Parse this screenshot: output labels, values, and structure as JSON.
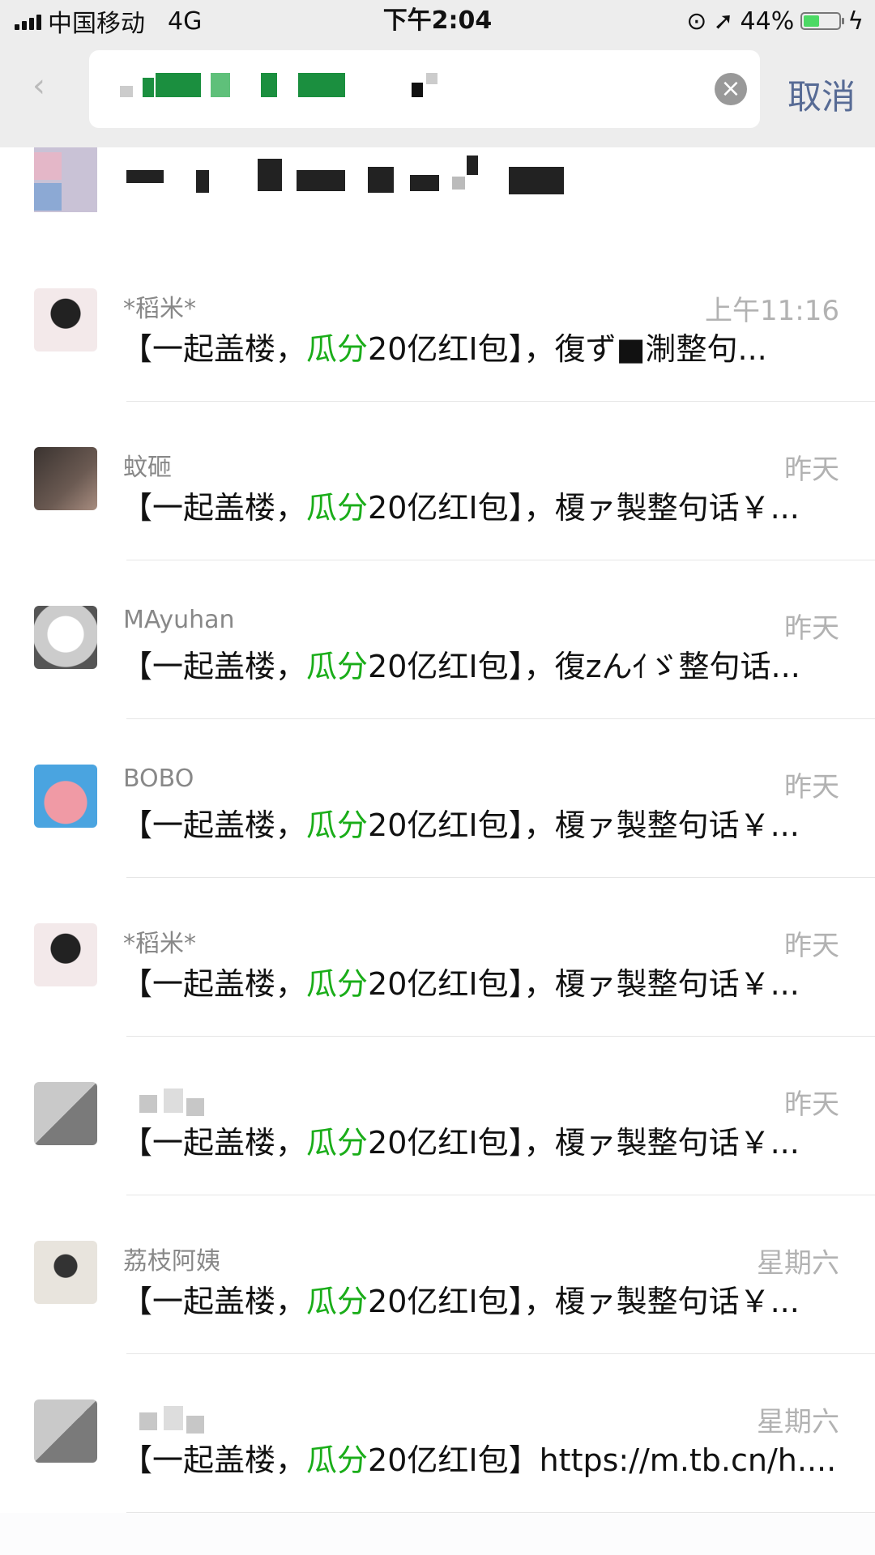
{
  "status_bar": {
    "carrier": "中国移动",
    "network": "4G",
    "time": "下午2:04",
    "battery_percent": "44%",
    "battery_level": 0.44
  },
  "search": {
    "cancel_label": "取消",
    "clear_icon": "clear-icon",
    "back_icon": "back-chevron-icon"
  },
  "results": [
    {
      "name": "*稻米*",
      "time": "上午11:16",
      "pre": "【一起盖楼，",
      "hl": "瓜分",
      "post": "20亿红I包】，復ず■淛整句...",
      "avatar": "av-anime"
    },
    {
      "name": "蚊砸",
      "time": "昨天",
      "pre": "【一起盖楼，",
      "hl": "瓜分",
      "post": "20亿红I包】，榎ァ製整句话￥...",
      "avatar": "av-girl"
    },
    {
      "name": "MAyuhan",
      "time": "昨天",
      "pre": "【一起盖楼，",
      "hl": "瓜分",
      "post": "20亿红I包】，復zんｲゞ整句话...",
      "avatar": "av-dog"
    },
    {
      "name": "BOBO",
      "time": "昨天",
      "pre": "【一起盖楼，",
      "hl": "瓜分",
      "post": "20亿红I包】，榎ァ製整句话￥...",
      "avatar": "av-patrick"
    },
    {
      "name": "*稻米*",
      "time": "昨天",
      "pre": "【一起盖楼，",
      "hl": "瓜分",
      "post": "20亿红I包】，榎ァ製整句话￥...",
      "avatar": "av-anime"
    },
    {
      "name": "",
      "time": "昨天",
      "pre": "【一起盖楼，",
      "hl": "瓜分",
      "post": "20亿红I包】，榎ァ製整句话￥...",
      "avatar": "av-grey"
    },
    {
      "name": "荔枝阿姨",
      "time": "星期六",
      "pre": "【一起盖楼，",
      "hl": "瓜分",
      "post": "20亿红I包】，榎ァ製整句话￥...",
      "avatar": "av-kid"
    },
    {
      "name": "",
      "time": "星期六",
      "pre": "【一起盖楼，",
      "hl": "瓜分",
      "post": "20亿红I包】https://m.tb.cn/h....",
      "avatar": "av-grey"
    }
  ]
}
